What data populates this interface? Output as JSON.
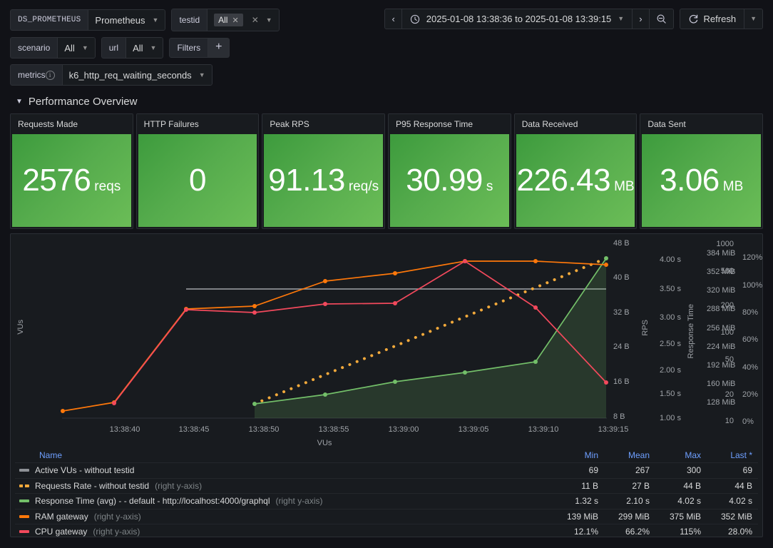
{
  "variables": {
    "row1": [
      {
        "label": "DS_PROMETHEUS",
        "value": "Prometheus",
        "type": "select"
      },
      {
        "label": "testid",
        "value": "All",
        "type": "multi"
      }
    ],
    "row2": [
      {
        "label": "scenario",
        "value": "All",
        "type": "select"
      },
      {
        "label": "url",
        "value": "All",
        "type": "select"
      }
    ],
    "filters_label": "Filters",
    "add_filter_label": "+",
    "row3": [
      {
        "label": "metrics",
        "value": "k6_http_req_waiting_seconds",
        "type": "select",
        "has_info": true
      }
    ]
  },
  "timepicker": {
    "prev_label": "‹",
    "next_label": "›",
    "range": "2025-01-08 13:38:36 to 2025-01-08 13:39:15",
    "clock_icon": "clock-icon",
    "zoom_out_icon": "zoom-out-icon",
    "refresh_label": "Refresh",
    "refresh_icon": "refresh-icon",
    "caret": "⌄"
  },
  "row": {
    "title": "Performance Overview",
    "collapse_icon": "chevron-down-icon"
  },
  "stats": [
    {
      "title": "Requests Made",
      "value": "2576",
      "unit": "reqs",
      "color": "#56ac4d"
    },
    {
      "title": "HTTP Failures",
      "value": "0",
      "unit": "",
      "color": "#56ac4d"
    },
    {
      "title": "Peak RPS",
      "value": "91.13",
      "unit": "req/s",
      "color": "#56ac4d"
    },
    {
      "title": "P95 Response Time",
      "value": "30.99",
      "unit": "s",
      "color": "#56ac4d"
    },
    {
      "title": "Data Received",
      "value": "226.43",
      "unit": "MB",
      "color": "#56ac4d"
    },
    {
      "title": "Data Sent",
      "value": "3.06",
      "unit": "MB",
      "color": "#56ac4d"
    }
  ],
  "chart_data": {
    "type": "line",
    "title": "",
    "xlabel": "VUs",
    "x_ticks": [
      "13:38:40",
      "13:38:45",
      "13:38:50",
      "13:38:55",
      "13:39:00",
      "13:39:05",
      "13:39:10",
      "13:39:15"
    ],
    "grid": false,
    "legend_position": "bottom-table",
    "axes": [
      {
        "id": "vus",
        "side": "left",
        "label": "VUs",
        "scale": "log",
        "ticks": [
          "1000",
          "500",
          "200",
          "100",
          "50",
          "20",
          "10"
        ]
      },
      {
        "id": "rate",
        "side": "right",
        "label": "",
        "scale": "linear",
        "ticks": [
          "48 B",
          "40 B",
          "32 B",
          "24 B",
          "16 B",
          "8 B"
        ]
      },
      {
        "id": "rps",
        "side": "right",
        "label": "RPS",
        "scale": "linear",
        "ticks": [
          "4.00 s",
          "3.50 s",
          "3.00 s",
          "2.50 s",
          "2.00 s",
          "1.50 s",
          "1.00 s"
        ]
      },
      {
        "id": "rt",
        "side": "right",
        "label": "Response Time",
        "scale": "linear",
        "ticks": [
          "384 MiB",
          "352 MiB",
          "320 MiB",
          "288 MiB",
          "256 MiB",
          "224 MiB",
          "192 MiB",
          "160 MiB",
          "128 MiB"
        ]
      },
      {
        "id": "cpu",
        "side": "right",
        "label": "",
        "scale": "linear",
        "ticks": [
          "120%",
          "100%",
          "80%",
          "60%",
          "40%",
          "20%",
          "0%"
        ]
      }
    ],
    "series": [
      {
        "name": "Active VUs - without testid",
        "color": "#8e9196",
        "style": "solid",
        "axis": "vus",
        "fill": false,
        "points": [
          [
            260,
            417
          ],
          [
            849,
            417
          ]
        ]
      },
      {
        "name": "Requests Rate - without testid (right y-axis)",
        "color": "#f2a93b",
        "style": "dashed",
        "axis": "rate",
        "fill": false,
        "points": [
          [
            356,
            578
          ],
          [
            455,
            537
          ],
          [
            553,
            497
          ],
          [
            651,
            456
          ],
          [
            750,
            415
          ],
          [
            849,
            374
          ]
        ]
      },
      {
        "name": "Response Time (avg) - - default - http://localhost:4000/graphql (right y-axis)",
        "color": "#73bf69",
        "style": "solid",
        "axis": "rt",
        "fill": true,
        "points": [
          [
            356,
            578
          ],
          [
            455,
            565
          ],
          [
            553,
            547
          ],
          [
            651,
            534
          ],
          [
            750,
            519
          ],
          [
            849,
            374
          ]
        ]
      },
      {
        "name": "RAM gateway (right y-axis)",
        "color": "#ff780a",
        "style": "solid",
        "axis": "rt",
        "fill": false,
        "points": [
          [
            87,
            588
          ],
          [
            159,
            576
          ],
          [
            260,
            445
          ],
          [
            356,
            441
          ],
          [
            455,
            406
          ],
          [
            553,
            395
          ],
          [
            651,
            378
          ],
          [
            750,
            378
          ],
          [
            849,
            383
          ]
        ]
      },
      {
        "name": "CPU gateway (right y-axis)",
        "color": "#f2495c",
        "style": "solid",
        "axis": "cpu",
        "fill": false,
        "points": [
          [
            159,
            577
          ],
          [
            260,
            446
          ],
          [
            356,
            450
          ],
          [
            455,
            438
          ],
          [
            553,
            437
          ],
          [
            651,
            378
          ],
          [
            750,
            443
          ],
          [
            849,
            548
          ]
        ]
      }
    ]
  },
  "legend": {
    "columns": [
      "Name",
      "Min",
      "Mean",
      "Max",
      "Last *"
    ],
    "rows": [
      {
        "color": "#8e9196",
        "style": "solid",
        "name": "Active VUs - without testid",
        "suffix": "",
        "min": "69",
        "mean": "267",
        "max": "300",
        "last": "69"
      },
      {
        "color": "#f2a93b",
        "style": "dashed",
        "name": "Requests Rate - without testid",
        "suffix": " (right y-axis)",
        "min": "11 B",
        "mean": "27 B",
        "max": "44 B",
        "last": "44 B"
      },
      {
        "color": "#73bf69",
        "style": "solid",
        "name": "Response Time (avg) - - default - http://localhost:4000/graphql",
        "suffix": " (right y-axis)",
        "min": "1.32 s",
        "mean": "2.10 s",
        "max": "4.02 s",
        "last": "4.02 s"
      },
      {
        "color": "#ff780a",
        "style": "solid",
        "name": "RAM gateway",
        "suffix": " (right y-axis)",
        "min": "139 MiB",
        "mean": "299 MiB",
        "max": "375 MiB",
        "last": "352 MiB"
      },
      {
        "color": "#f2495c",
        "style": "solid",
        "name": "CPU gateway",
        "suffix": " (right y-axis)",
        "min": "12.1%",
        "mean": "66.2%",
        "max": "115%",
        "last": "28.0%"
      }
    ]
  }
}
